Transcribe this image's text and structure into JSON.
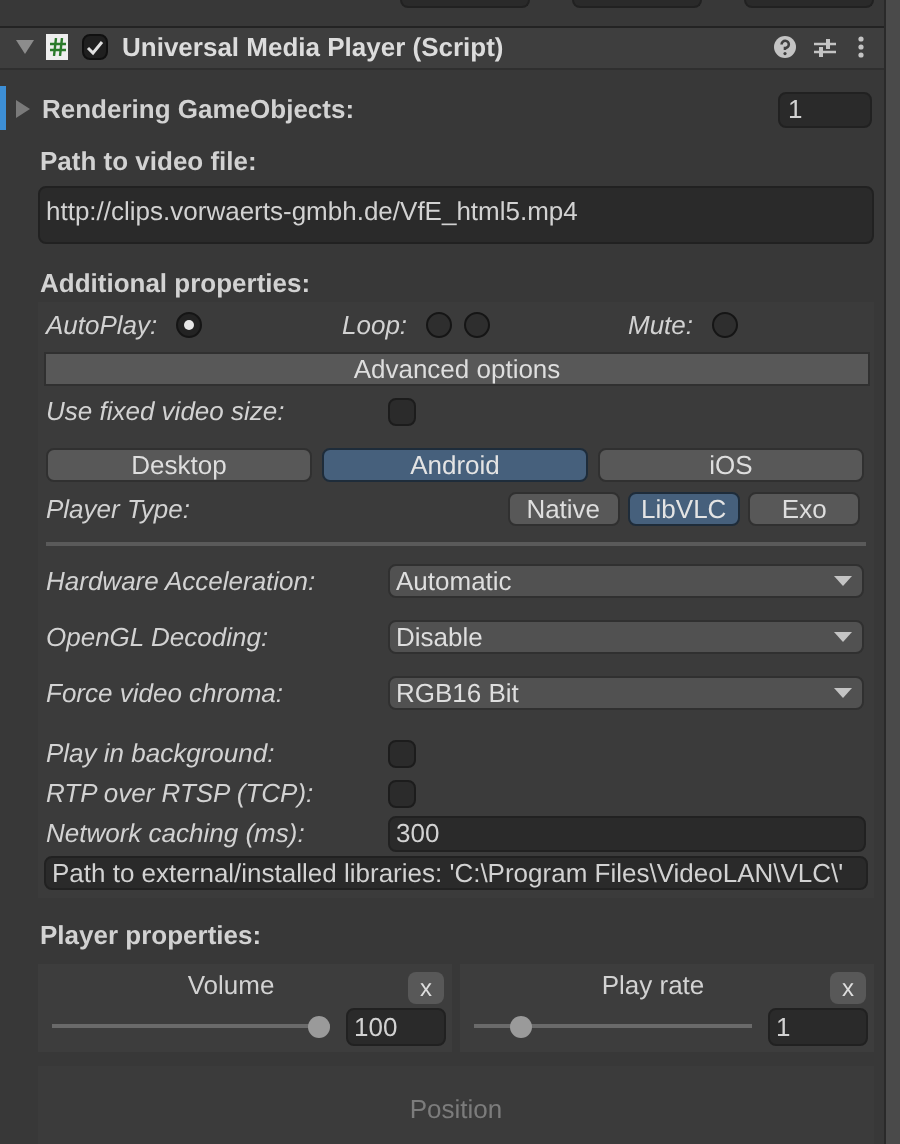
{
  "component": {
    "title": "Universal Media Player (Script)",
    "enabled": true,
    "expanded": true
  },
  "rendering_gameobjects": {
    "label": "Rendering GameObjects:",
    "value": "1",
    "expanded": false
  },
  "video_path": {
    "label": "Path to video file:",
    "value": "http://clips.vorwaerts-gmbh.de/VfE_html5.mp4"
  },
  "additional": {
    "heading": "Additional properties:",
    "toggles": [
      {
        "label": "AutoPlay:",
        "radios": [
          {
            "checked": true
          }
        ]
      },
      {
        "label": "Loop:",
        "radios": [
          {
            "checked": false
          },
          {
            "checked": false
          }
        ]
      },
      {
        "label": "Mute:",
        "radios": [
          {
            "checked": false
          }
        ]
      }
    ],
    "advanced_button": "Advanced options",
    "fixed_size": {
      "label": "Use fixed video size:",
      "checked": false
    },
    "platforms": [
      {
        "label": "Desktop",
        "selected": false
      },
      {
        "label": "Android",
        "selected": true
      },
      {
        "label": "iOS",
        "selected": false
      }
    ],
    "player_type": {
      "label": "Player Type:",
      "options": [
        {
          "label": "Native",
          "selected": false
        },
        {
          "label": "LibVLC",
          "selected": true
        },
        {
          "label": "Exo",
          "selected": false
        }
      ]
    },
    "settings": [
      {
        "kind": "dropdown",
        "label": "Hardware Acceleration:",
        "value": "Automatic"
      },
      {
        "kind": "dropdown",
        "label": "OpenGL Decoding:",
        "value": "Disable"
      },
      {
        "kind": "dropdown",
        "label": "Force video chroma:",
        "value": "RGB16 Bit"
      },
      {
        "kind": "checkbox",
        "label": "Play in background:",
        "checked": false
      },
      {
        "kind": "checkbox",
        "label": "RTP over RTSP (TCP):",
        "checked": false
      },
      {
        "kind": "number",
        "label": "Network caching (ms):",
        "value": "300"
      }
    ],
    "libraries_path": "Path to external/installed libraries: 'C:\\Program Files\\VideoLAN\\VLC\\'"
  },
  "player_properties": {
    "heading": "Player properties:",
    "sliders": [
      {
        "label": "Volume",
        "reset": "x",
        "level": 1.0,
        "value": "100"
      },
      {
        "label": "Play rate",
        "reset": "x",
        "level": 0.14,
        "value": "1"
      }
    ]
  },
  "position": {
    "label": "Position",
    "disabled": true
  }
}
